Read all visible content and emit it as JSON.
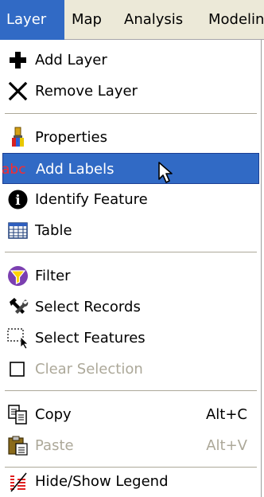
{
  "menubar": {
    "items": [
      {
        "label": "Layer",
        "active": true
      },
      {
        "label": "Map"
      },
      {
        "label": "Analysis"
      },
      {
        "label": "Modelin"
      }
    ]
  },
  "menu": {
    "items": [
      {
        "label": "Add Layer",
        "icon": "plus-icon"
      },
      {
        "label": "Remove Layer",
        "icon": "x-icon"
      },
      {
        "label": "Properties",
        "icon": "paintbrush-icon"
      },
      {
        "label": "Add Labels",
        "icon": "abc-labels-icon",
        "highlighted": true,
        "icon_text": "abc"
      },
      {
        "label": "Identify Feature",
        "icon": "info-icon",
        "icon_text": "i"
      },
      {
        "label": "Table",
        "icon": "table-icon"
      },
      {
        "label": "Filter",
        "icon": "filter-icon"
      },
      {
        "label": "Select Records",
        "icon": "hammer-wrench-icon"
      },
      {
        "label": "Select Features",
        "icon": "select-features-icon"
      },
      {
        "label": "Clear Selection",
        "icon": "checkbox-icon",
        "disabled": true
      },
      {
        "label": "Copy",
        "icon": "copy-icon",
        "shortcut": "Alt+C"
      },
      {
        "label": "Paste",
        "icon": "paste-icon",
        "shortcut": "Alt+V",
        "disabled": true
      },
      {
        "label": "Hide/Show Legend",
        "icon": "legend-icon"
      }
    ]
  },
  "colors": {
    "highlight": "#316ac5",
    "menubar_bg": "#ece9d8",
    "disabled_text": "#aca899"
  }
}
